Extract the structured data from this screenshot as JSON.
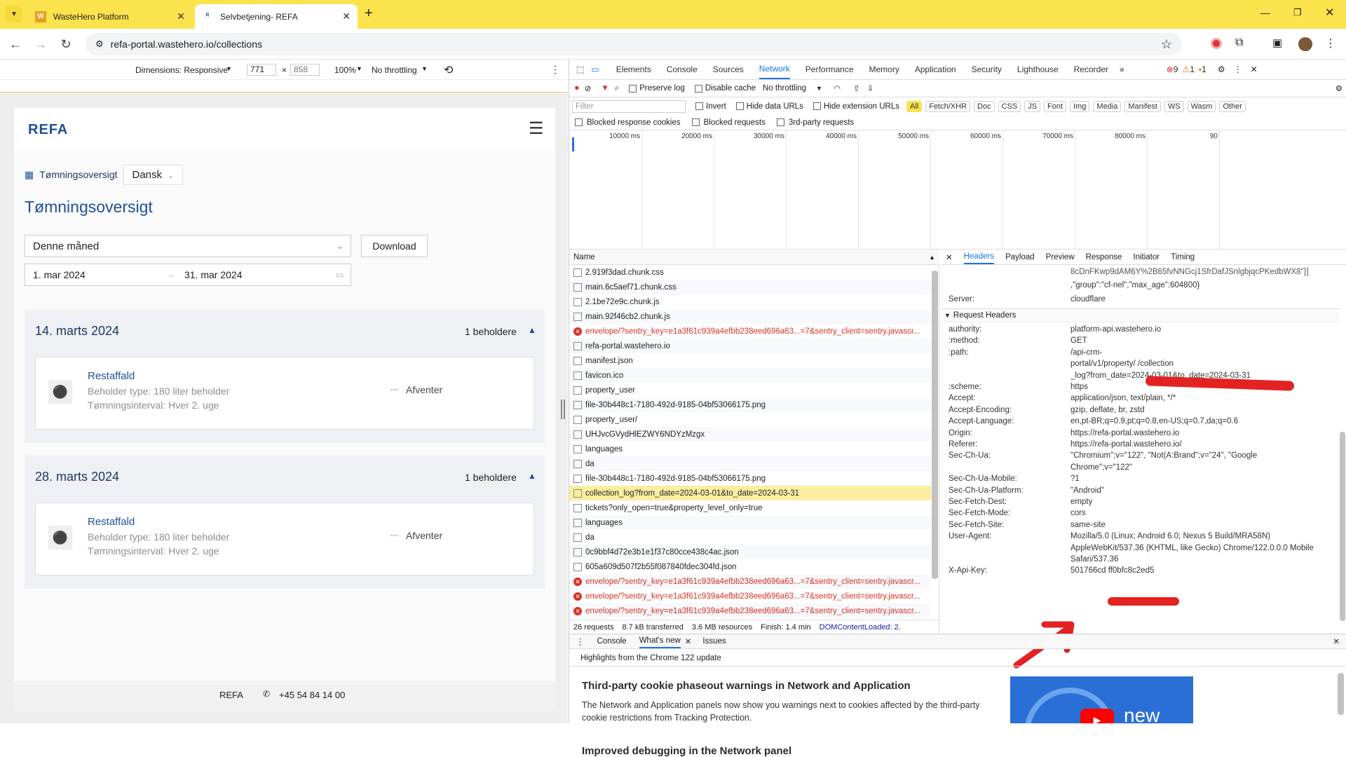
{
  "browser": {
    "tabs": [
      {
        "title": "WasteHero Platform"
      },
      {
        "title": "Selvbetjening- REFA"
      }
    ],
    "url": "refa-portal.wastehero.io/collections"
  },
  "device_toolbar": {
    "dimensions": "Dimensions: Responsive",
    "width": "771",
    "height": "858",
    "zoom": "100%",
    "throttling": "No throttling"
  },
  "page": {
    "logo": "REFA",
    "breadcrumb": "Tømningsoversigt",
    "language": "Dansk",
    "title": "Tømningsoversigt",
    "period": "Denne måned",
    "download": "Download",
    "date_from": "1. mar 2024",
    "date_to": "31. mar 2024",
    "cards": [
      {
        "date": "14. marts 2024",
        "count": "1 beholdere",
        "name": "Restaffald",
        "type": "Beholder type: 180 liter beholder",
        "interval": "Tømningsinterval: Hver 2. uge",
        "status": "Afventer"
      },
      {
        "date": "28. marts 2024",
        "count": "1 beholdere",
        "name": "Restaffald",
        "type": "Beholder type: 180 liter beholder",
        "interval": "Tømningsinterval: Hver 2. uge",
        "status": "Afventer"
      }
    ],
    "footer_name": "REFA",
    "footer_phone": "+45 54 84 14 00"
  },
  "devtools": {
    "tabs": [
      "Elements",
      "Console",
      "Sources",
      "Network",
      "Performance",
      "Memory",
      "Application",
      "Security",
      "Lighthouse",
      "Recorder"
    ],
    "errors": "9",
    "warnings": "1",
    "issues": "1",
    "preserve_log": "Preserve log",
    "disable_cache": "Disable cache",
    "throttling": "No throttling",
    "filter_placeholder": "Filter",
    "invert": "Invert",
    "hide_data": "Hide data URLs",
    "hide_ext": "Hide extension URLs",
    "types": [
      "All",
      "Fetch/XHR",
      "Doc",
      "CSS",
      "JS",
      "Font",
      "Img",
      "Media",
      "Manifest",
      "WS",
      "Wasm",
      "Other"
    ],
    "blocked_cookies": "Blocked response cookies",
    "blocked_requests": "Blocked requests",
    "third_party": "3rd-party requests",
    "timeline_ticks": [
      "10000 ms",
      "20000 ms",
      "30000 ms",
      "40000 ms",
      "50000 ms",
      "60000 ms",
      "70000 ms",
      "80000 ms",
      "90"
    ],
    "name_header": "Name",
    "requests": [
      {
        "name": "2.919f3dad.chunk.css",
        "err": false
      },
      {
        "name": "main.6c5aef71.chunk.css",
        "err": false
      },
      {
        "name": "2.1be72e9c.chunk.js",
        "err": false
      },
      {
        "name": "main.92f46cb2.chunk.js",
        "err": false
      },
      {
        "name": "envelope/?sentry_key=e1a3f61c939a4efbb238eed696a63...=7&sentry_client=sentry.javascr...",
        "err": true
      },
      {
        "name": "refa-portal.wastehero.io",
        "err": false
      },
      {
        "name": "manifest.json",
        "err": false
      },
      {
        "name": "favicon.ico",
        "err": false
      },
      {
        "name": "property_user",
        "err": false
      },
      {
        "name": "file-30b448c1-7180-492d-9185-04bf53066175.png",
        "err": false
      },
      {
        "name": "property_user/",
        "err": false
      },
      {
        "name": "UHJvcGVydHlEZWY6NDYzMzgx",
        "err": false
      },
      {
        "name": "languages",
        "err": false
      },
      {
        "name": "da",
        "err": false
      },
      {
        "name": "file-30b448c1-7180-492d-9185-04bf53066175.png",
        "err": false
      },
      {
        "name": "collection_log?from_date=2024-03-01&to_date=2024-03-31",
        "err": false,
        "selected": true
      },
      {
        "name": "tickets?only_open=true&property_level_only=true",
        "err": false
      },
      {
        "name": "languages",
        "err": false
      },
      {
        "name": "da",
        "err": false
      },
      {
        "name": "0c9bbf4d72e3b1e1f37c80cce438c4ac.json",
        "err": false
      },
      {
        "name": "605a609d507f2b55f087840fdec304fd.json",
        "err": false
      },
      {
        "name": "envelope/?sentry_key=e1a3f61c939a4efbb238eed696a63...=7&sentry_client=sentry.javascr...",
        "err": true
      },
      {
        "name": "envelope/?sentry_key=e1a3f61c939a4efbb238eed696a63...=7&sentry_client=sentry.javascr...",
        "err": true
      },
      {
        "name": "envelope/?sentry_key=e1a3f61c939a4efbb238eed696a63...=7&sentry_client=sentry.javascr...",
        "err": true
      }
    ],
    "status": [
      "26 requests",
      "8.7 kB transferred",
      "3.6 MB resources",
      "Finish: 1.4 min",
      "DOMContentLoaded: 2."
    ],
    "detail_tabs": [
      "Headers",
      "Payload",
      "Preview",
      "Response",
      "Initiator",
      "Timing"
    ],
    "resp_top1": "8cDnFKwp9dAM6Y%2B65fvNNGcj1SfrDafJSnlgbjqcPKedbWX8\"}]",
    "resp_top2": ",\"group\":\"cf-nel\",\"max_age\":604800}",
    "server_key": "Server:",
    "server_val": "cloudflare",
    "req_headers_title": "Request Headers",
    "headers": [
      [
        "authority:",
        "platform-api.wastehero.io"
      ],
      [
        ":method:",
        "GET"
      ],
      [
        ":path:",
        "/api-crm-"
      ],
      [
        "",
        "portal/v1/property/                                              /collection"
      ],
      [
        "",
        "_log?from_date=2024-03-01&to_date=2024-03-31"
      ],
      [
        ":scheme:",
        "https"
      ],
      [
        "Accept:",
        "application/json, text/plain, */*"
      ],
      [
        "Accept-Encoding:",
        "gzip, deflate, br, zstd"
      ],
      [
        "Accept-Language:",
        "en,pt-BR;q=0.9,pt;q=0.8,en-US;q=0.7,da;q=0.6"
      ],
      [
        "Origin:",
        "https://refa-portal.wastehero.io"
      ],
      [
        "Referer:",
        "https://refa-portal.wastehero.io/"
      ],
      [
        "Sec-Ch-Ua:",
        "\"Chromium\";v=\"122\", \"Not(A:Brand\";v=\"24\", \"Google"
      ],
      [
        "",
        "Chrome\";v=\"122\""
      ],
      [
        "Sec-Ch-Ua-Mobile:",
        "?1"
      ],
      [
        "Sec-Ch-Ua-Platform:",
        "\"Android\""
      ],
      [
        "Sec-Fetch-Dest:",
        "empty"
      ],
      [
        "Sec-Fetch-Mode:",
        "cors"
      ],
      [
        "Sec-Fetch-Site:",
        "same-site"
      ],
      [
        "User-Agent:",
        "Mozilla/5.0 (Linux; Android 6.0; Nexus 5 Build/MRA58N)"
      ],
      [
        "",
        "AppleWebKit/537.36 (KHTML, like Gecko) Chrome/122.0.0.0 Mobile"
      ],
      [
        "",
        "Safari/537.36"
      ],
      [
        "X-Api-Key:",
        "501766cd                    ff0bfc8c2ed5"
      ]
    ],
    "drawer_tabs": [
      "Console",
      "What's new",
      "Issues"
    ],
    "drawer_highlight": "Highlights from the Chrome 122 update",
    "whatsnew_h1": "Third-party cookie phaseout warnings in Network and Application",
    "whatsnew_p1": "The Network and Application panels now show you warnings next to cookies affected by the third-party cookie restrictions from Tracking Protection.",
    "whatsnew_h2": "Improved debugging in the Network panel",
    "video_label": "new"
  },
  "colors": {
    "chrome_yellow": "#fbe34e",
    "refa_blue": "#1f4e9c",
    "selected_row": "#fbeea0",
    "error_red": "#d93025"
  }
}
